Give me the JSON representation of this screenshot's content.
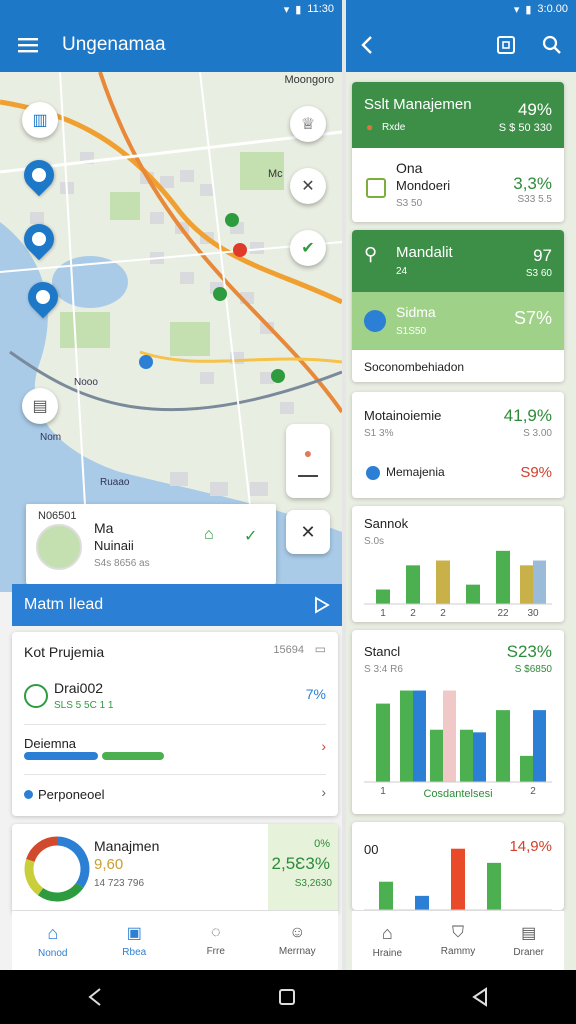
{
  "status_bar": {
    "time_left": "11:30",
    "time_right": "3:0.00"
  },
  "left_app": {
    "title": "Ungenamaa",
    "map_labels": {
      "top_right": "Moongoro",
      "mid_right": "Mc",
      "water": "Nooo",
      "water2": "Nom",
      "bay": "Ruaao"
    },
    "popup": {
      "tag": "N06501",
      "name": "Ma",
      "subtitle": "Nuinaii",
      "meta": "S4s 8656 as"
    },
    "banner": {
      "label": "Matm Ilead"
    },
    "list_card": {
      "title": "Kot Prujemia",
      "count": "15694",
      "item1": {
        "name": "Drai002",
        "sub": "SLS 5 5C 1 1",
        "value": "7%"
      },
      "item2": {
        "name": "Deiemna"
      },
      "item3": {
        "name": "Perponeoel"
      }
    },
    "donut_card": {
      "title": "Manajmen",
      "value": "9,60",
      "sub": "14 723 796",
      "pct": "0%",
      "amount": "2,5Ɛ3%",
      "amount_sub": "S3,2630"
    },
    "donut_slices": [
      {
        "value": 35,
        "color": "#2b7fd4"
      },
      {
        "value": 25,
        "color": "#2e9b3e"
      },
      {
        "value": 20,
        "color": "#c9cf3a"
      },
      {
        "value": 20,
        "color": "#d24a2e"
      }
    ],
    "bottom_nav": [
      "Nonod",
      "Rbea",
      "Frre",
      "Merrnay"
    ]
  },
  "right_app": {
    "card1": {
      "title": "Sslt Manajemen",
      "sub": "Rxde",
      "pct": "49%",
      "amount": "S $ 50 330"
    },
    "card2": {
      "title": "Ona",
      "subtitle": "Mondoeri",
      "meta": "S3 50",
      "pct": "3,3%",
      "amount": "S33 5.5"
    },
    "card3": {
      "title": "Mandalit",
      "sub": "24",
      "pct": "97",
      "amount": "S3 60"
    },
    "card3b": {
      "title": "Sidma",
      "sub": "S1S50",
      "pct": "S7%"
    },
    "section_label": "Soconombehiadon",
    "card4": {
      "title": "Motainoiemie",
      "sub": "S1 3%",
      "pct": "41,9%",
      "amount": "S 3.00",
      "item": "Memajenia",
      "item_pct": "S9%"
    },
    "chart1": {
      "title": "Sannok",
      "sub": "S.0s"
    },
    "chart2": {
      "title": "Stancl",
      "sub": "S 3:4 R6",
      "pct": "S23%",
      "amount": "S $6850",
      "caption": "Cosdantelsesi"
    },
    "chart3": {
      "title": "00",
      "pct": "14,9%"
    },
    "bottom_nav": [
      "Hraine",
      "Rammy",
      "Draner"
    ]
  },
  "chart_data": [
    {
      "type": "bar",
      "categories": [
        "1",
        "2",
        "2",
        "",
        "22",
        "30"
      ],
      "series": [
        {
          "values": [
            15,
            40,
            0,
            20,
            55,
            0
          ],
          "color": "#4caf50"
        },
        {
          "values": [
            0,
            0,
            45,
            0,
            0,
            40
          ],
          "color": "#c9b14a"
        },
        {
          "values": [
            0,
            0,
            0,
            0,
            0,
            45
          ],
          "color": "#9bbcd9"
        }
      ]
    },
    {
      "type": "bar",
      "categories": [
        "1",
        "",
        "",
        "",
        "",
        "2"
      ],
      "series": [
        {
          "values": [
            60,
            70,
            40,
            40,
            55,
            20
          ],
          "color": "#4caf50"
        },
        {
          "values": [
            0,
            70,
            0,
            38,
            0,
            55
          ],
          "color": "#2b7fd4"
        },
        {
          "values": [
            0,
            0,
            70,
            0,
            0,
            0
          ],
          "color": "#f0c8c8"
        }
      ]
    },
    {
      "type": "bar",
      "categories": [
        "",
        "",
        "",
        "",
        ""
      ],
      "series": [
        {
          "values": [
            30,
            0,
            0,
            50,
            0
          ],
          "color": "#4caf50"
        },
        {
          "values": [
            0,
            15,
            0,
            0,
            0
          ],
          "color": "#2b7fd4"
        },
        {
          "values": [
            0,
            0,
            65,
            0,
            0
          ],
          "color": "#e84a2a"
        }
      ]
    }
  ]
}
